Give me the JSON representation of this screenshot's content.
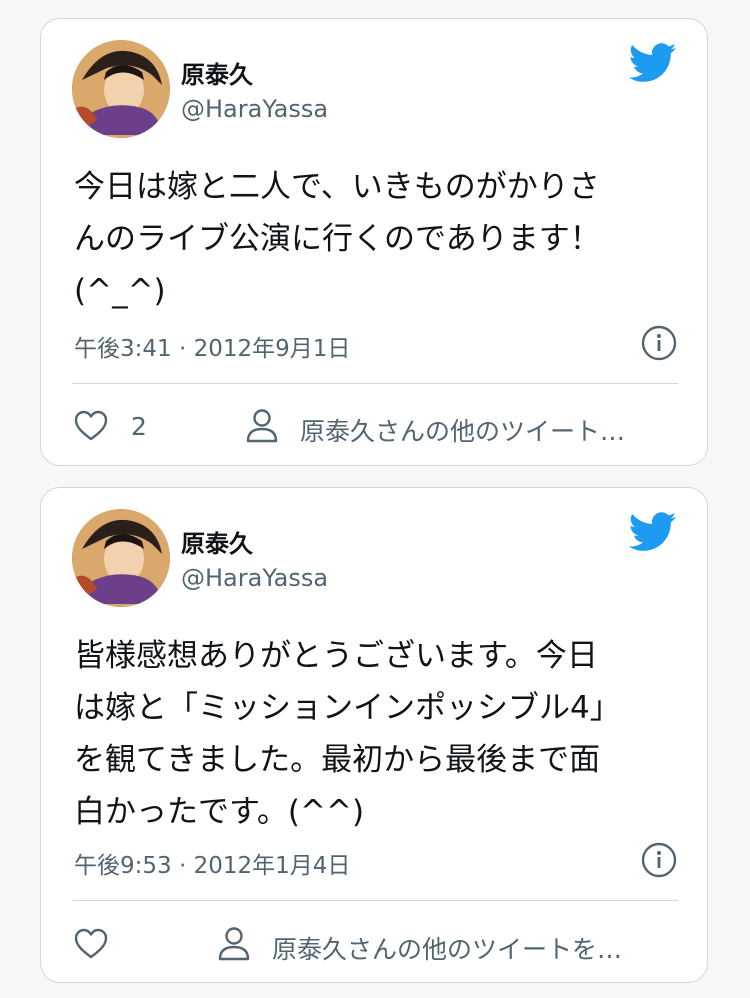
{
  "tweets": [
    {
      "name": "原泰久",
      "handle": "@HaraYassa",
      "text": "今日は嫁と二人で、いきものがかりさ\nんのライブ公演に行くのであります！\n(^_^)",
      "timestamp": "午後3:41 · 2012年9月1日",
      "likes": "2",
      "more_link": "原泰久さんの他のツイート…"
    },
    {
      "name": "原泰久",
      "handle": "@HaraYassa",
      "text": "皆様感想ありがとうございます。今日\nは嫁と「ミッションインポッシブル4」\nを観てきました。最初から最後まで面\n白かったです。(^^)",
      "timestamp": "午後9:53 · 2012年1月4日",
      "likes": "",
      "more_link": "原泰久さんの他のツイートを…"
    }
  ],
  "colors": {
    "twitter_blue": "#1d9bf0",
    "text": "#0f1419",
    "secondary": "#536471",
    "border": "#cfd9de"
  },
  "icons": [
    "twitter-bird-icon",
    "info-icon",
    "heart-icon",
    "person-icon"
  ]
}
